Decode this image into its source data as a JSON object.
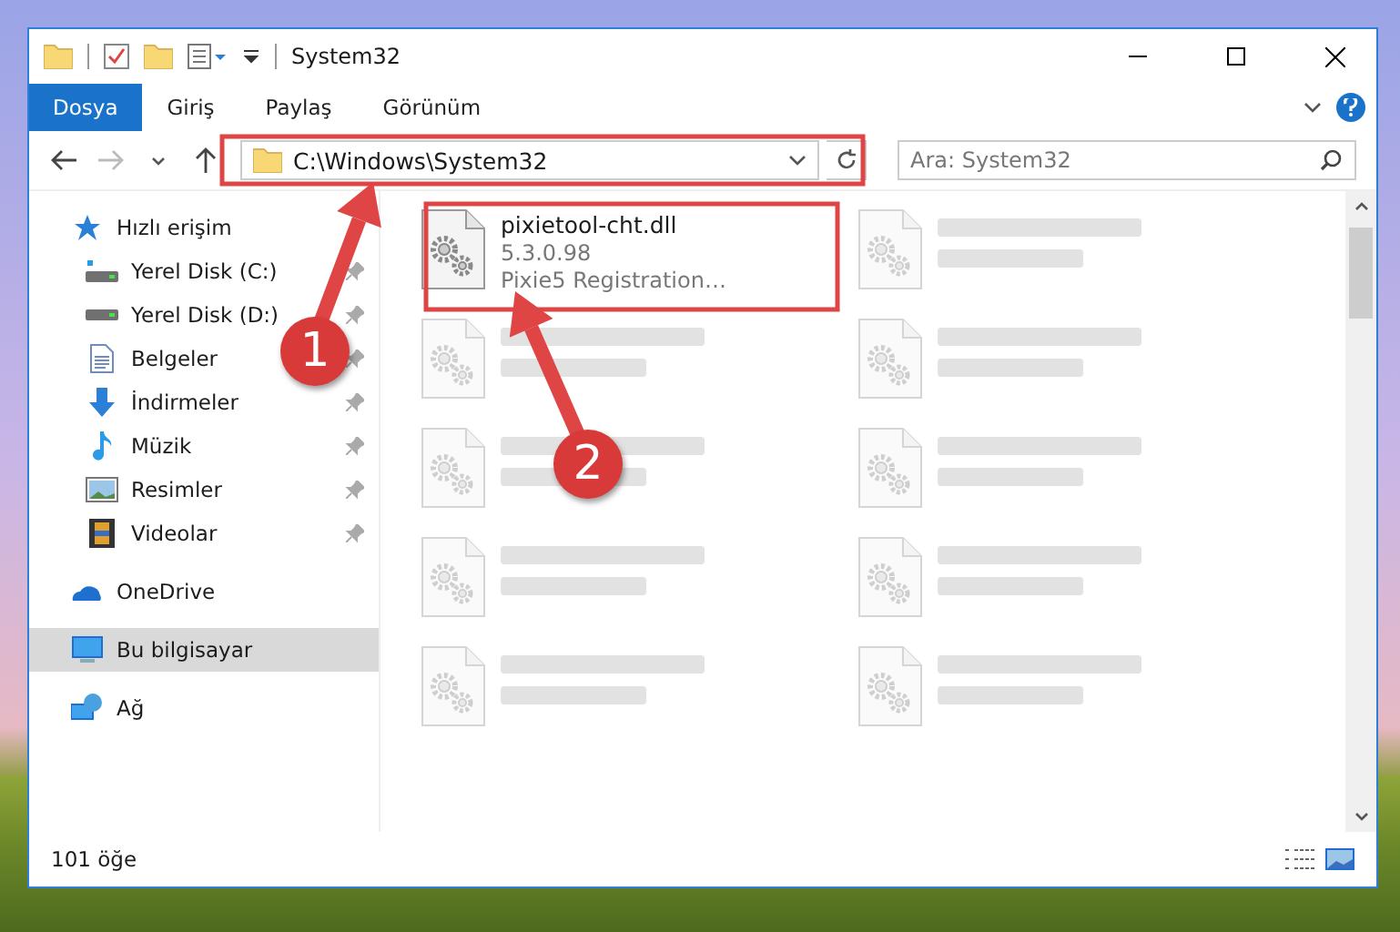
{
  "window": {
    "title": "System32"
  },
  "ribbon_tabs": [
    {
      "label": "Dosya",
      "selected": true
    },
    {
      "label": "Giriş",
      "selected": false
    },
    {
      "label": "Paylaş",
      "selected": false
    },
    {
      "label": "Görünüm",
      "selected": false
    }
  ],
  "address_bar": {
    "path": "C:\\Windows\\System32"
  },
  "search": {
    "placeholder": "Ara: System32"
  },
  "navigation": [
    {
      "label": "Hızlı erişim",
      "selected": false,
      "children": [
        {
          "label": "Yerel Disk (C:)",
          "selected": false,
          "pinned": true
        },
        {
          "label": "Yerel Disk (D:)",
          "selected": false,
          "pinned": true
        },
        {
          "label": "Belgeler",
          "selected": false,
          "pinned": true
        },
        {
          "label": "İndirmeler",
          "selected": false,
          "pinned": true
        },
        {
          "label": "Müzik",
          "selected": false,
          "pinned": true
        },
        {
          "label": "Resimler",
          "selected": false,
          "pinned": true
        },
        {
          "label": "Videolar",
          "selected": false,
          "pinned": true
        }
      ]
    },
    {
      "label": "OneDrive",
      "selected": false
    },
    {
      "label": "Bu bilgisayar",
      "selected": true
    },
    {
      "label": "Ağ",
      "selected": false
    }
  ],
  "files": [
    {
      "name": "pixietool-cht.dll",
      "details": [
        "5.3.0.98",
        "Pixie5 Registration…"
      ],
      "blurred": false
    },
    {
      "blurred": true
    },
    {
      "blurred": true
    },
    {
      "blurred": true
    },
    {
      "blurred": true
    },
    {
      "blurred": true
    },
    {
      "blurred": true
    },
    {
      "blurred": true
    },
    {
      "blurred": true
    },
    {
      "blurred": true
    }
  ],
  "status_bar": {
    "item_count": "101 öğe"
  },
  "annotations": [
    {
      "label": "1"
    },
    {
      "label": "2"
    }
  ]
}
